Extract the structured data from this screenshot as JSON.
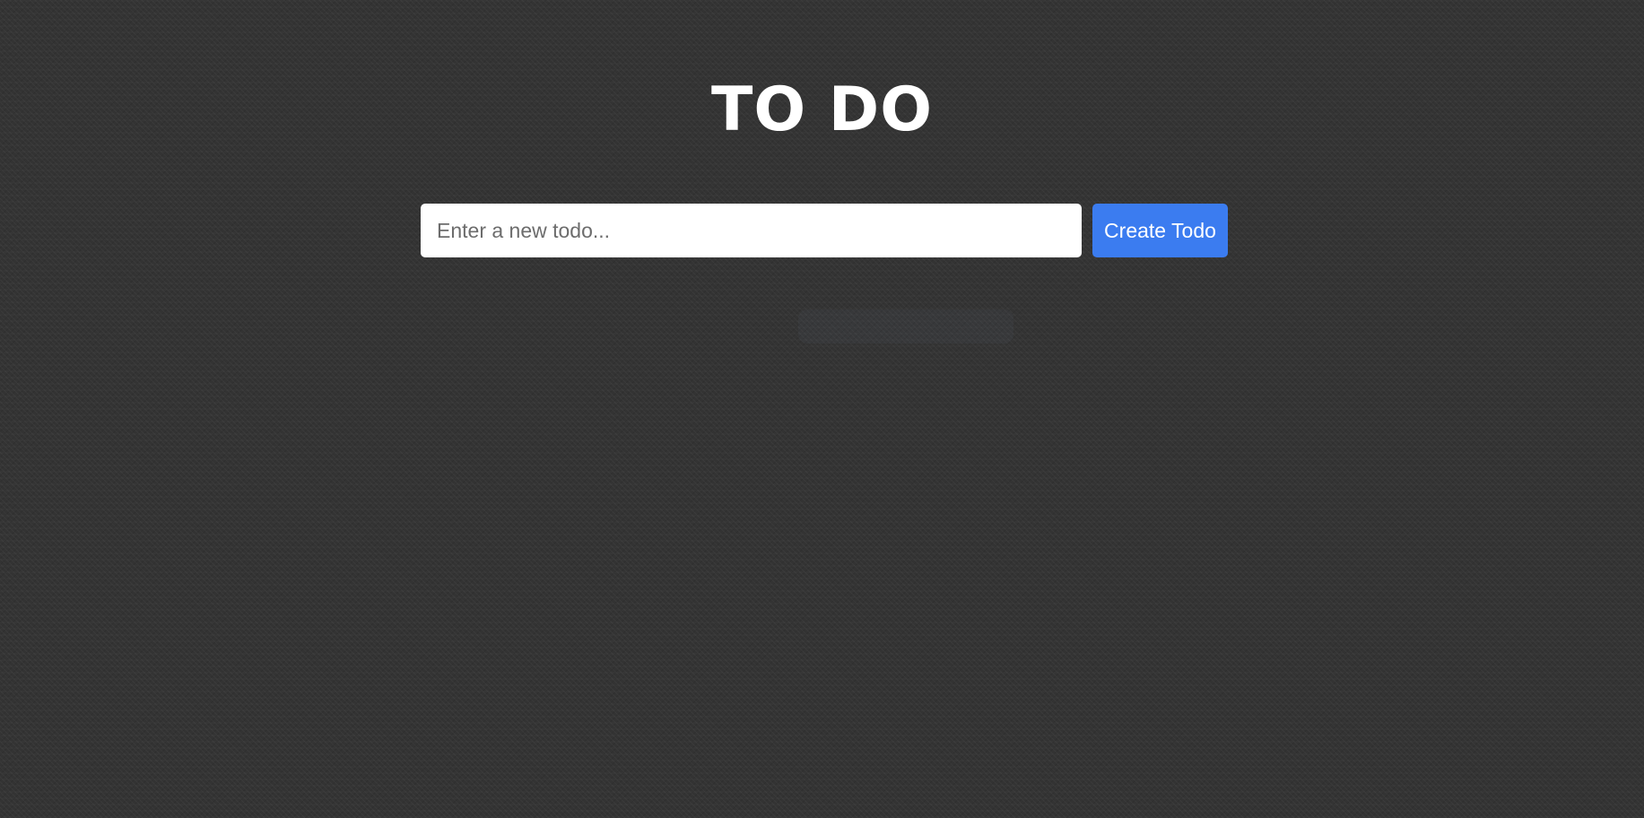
{
  "header": {
    "title": "TO DO"
  },
  "form": {
    "input_placeholder": "Enter a new todo...",
    "input_value": "",
    "create_label": "Create Todo"
  },
  "colors": {
    "background": "#333333",
    "title": "#ffffff",
    "input_background": "#ffffff",
    "button_background": "#3b7cf0",
    "button_text": "#ffffff"
  }
}
